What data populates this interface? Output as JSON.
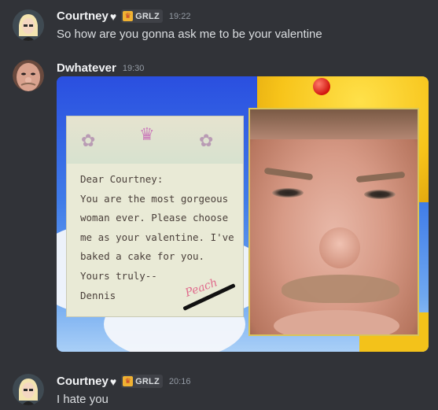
{
  "messages": [
    {
      "username": "Courtney",
      "heart": "♥",
      "tag": "GRLZ",
      "time": "19:22",
      "text": "So how are you gonna ask me to be your valentine"
    },
    {
      "username": "Dwhatever",
      "time": "19:30",
      "attachment": {
        "letter_lines": [
          "Dear Courtney:",
          "You are the most gorgeous",
          "woman ever. Please choose",
          "me as your valentine. I've",
          "baked a cake for you.",
          "Yours truly--",
          "Dennis"
        ],
        "crossed_signature": "Peach"
      }
    },
    {
      "username": "Courtney",
      "heart": "♥",
      "tag": "GRLZ",
      "time": "20:16",
      "text": "I hate you"
    }
  ]
}
